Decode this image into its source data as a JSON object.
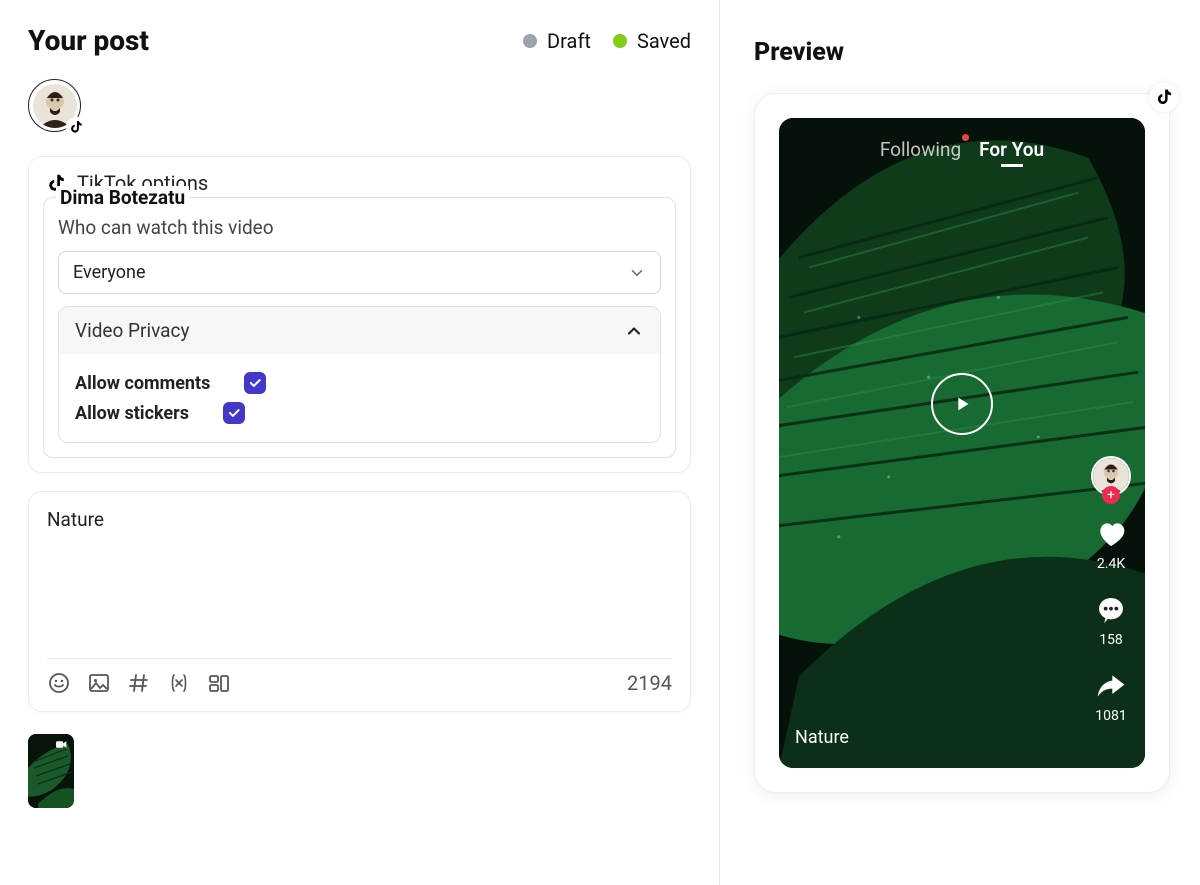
{
  "header": {
    "title": "Your post",
    "statuses": [
      {
        "label": "Draft",
        "color": "#9ca3af"
      },
      {
        "label": "Saved",
        "color": "#84cc16"
      }
    ]
  },
  "tiktok_options": {
    "header_label": "TikTok options",
    "account_name": "Dima Botezatu",
    "privacy_label": "Who can watch this video",
    "privacy_selected": "Everyone",
    "video_privacy_label": "Video Privacy",
    "allow_comments_label": "Allow comments",
    "allow_comments_checked": true,
    "allow_stickers_label": "Allow stickers",
    "allow_stickers_checked": true
  },
  "caption": {
    "text": "Nature",
    "char_count": "2194"
  },
  "preview": {
    "title": "Preview",
    "tabs": {
      "following": "Following",
      "for_you": "For You"
    },
    "likes": "2.4K",
    "comments": "158",
    "shares": "1081",
    "caption": "Nature"
  }
}
